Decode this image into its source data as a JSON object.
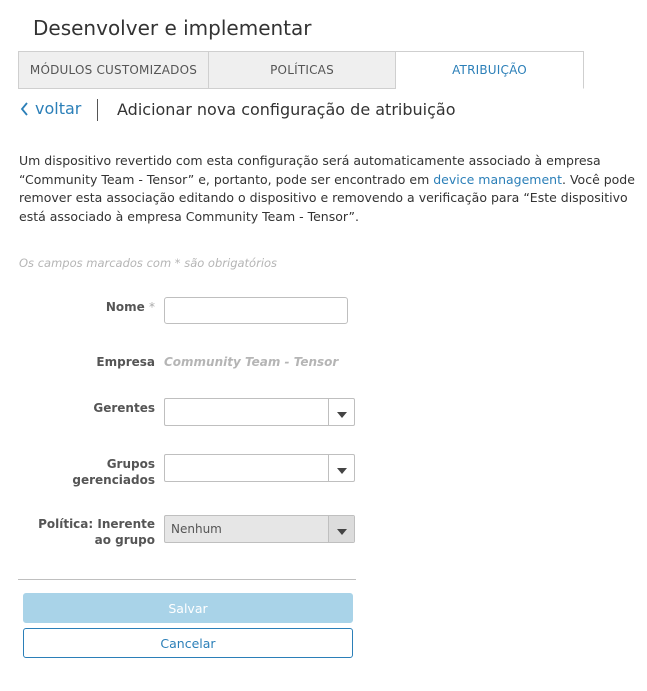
{
  "page": {
    "title": "Desenvolver e implementar"
  },
  "tabs": [
    {
      "label": "MÓDULOS CUSTOMIZADOS",
      "active": false
    },
    {
      "label": "POLÍTICAS",
      "active": false
    },
    {
      "label": "ATRIBUIÇÃO",
      "active": true
    }
  ],
  "header": {
    "back_label": "voltar",
    "title": "Adicionar nova configuração de atribuição"
  },
  "description": {
    "part1": "Um dispositivo revertido com esta configuração será automaticamente associado à empresa “Community Team - Tensor” e, portanto, pode ser encontrado em ",
    "link": "device management",
    "part2": ". Você pode remover esta associação editando o dispositivo e removendo a verificação para “Este dispositivo está associado à empresa Community Team - Tensor”."
  },
  "form": {
    "required_note": "Os campos marcados com * são obrigatórios",
    "name_label": "Nome",
    "required_star": "*",
    "name_value": "",
    "company_label": "Empresa",
    "company_value": "Community Team - Tensor",
    "managers_label": "Gerentes",
    "managers_value": "",
    "groups_label_line1": "Grupos",
    "groups_label_line2": "gerenciados",
    "groups_value": "",
    "policy_label_line1": "Política: Inerente",
    "policy_label_line2": "ao grupo",
    "policy_value": "Nenhum"
  },
  "actions": {
    "save_label": "Salvar",
    "cancel_label": "Cancelar"
  },
  "colors": {
    "accent": "#2b7fb8",
    "save_disabled": "#a9d3e8"
  },
  "icons": {
    "back": "chevron-left-icon",
    "dropdown": "caret-down-icon"
  }
}
